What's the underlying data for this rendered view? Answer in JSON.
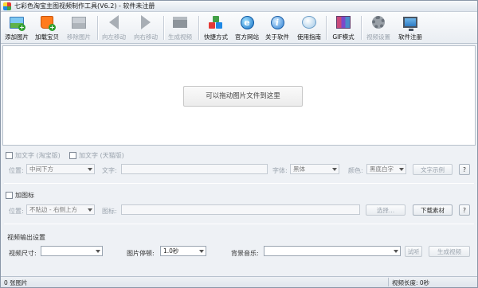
{
  "window": {
    "title": "七彩色淘宝主图视频制作工具(V6.2) - 软件未注册"
  },
  "toolbar": {
    "buttons": [
      {
        "label": "添加图片",
        "icon": "add-image-icon",
        "enabled": true
      },
      {
        "label": "加载宝贝",
        "icon": "taobao-bag-icon",
        "enabled": true
      },
      {
        "label": "移除图片",
        "icon": "remove-image-icon",
        "enabled": false
      },
      {
        "label": "向左移动",
        "icon": "arrow-left-icon",
        "enabled": false
      },
      {
        "label": "向右移动",
        "icon": "arrow-right-icon",
        "enabled": false
      },
      {
        "label": "生成视频",
        "icon": "clapperboard-icon",
        "enabled": false
      },
      {
        "label": "快捷方式",
        "icon": "cubes-icon",
        "enabled": true
      },
      {
        "label": "官方网站",
        "icon": "ie-globe-icon",
        "enabled": true
      },
      {
        "label": "关于软件",
        "icon": "info-icon",
        "enabled": true
      },
      {
        "label": "使用指南",
        "icon": "help-icon",
        "enabled": true
      },
      {
        "label": "GIF模式",
        "icon": "gif-icon",
        "enabled": true
      },
      {
        "label": "视频设置",
        "icon": "gear-icon",
        "enabled": false
      },
      {
        "label": "软件注册",
        "icon": "monitor-icon",
        "enabled": true
      }
    ]
  },
  "drop_area": {
    "hint": "可以拖动图片文件到这里"
  },
  "text_section": {
    "checkbox_taobao": "加文字 (淘宝版)",
    "checkbox_tmall": "加文字 (天猫版)",
    "position_label": "位置:",
    "position_value": "中间下方",
    "text_label": "文字:",
    "text_value": "",
    "font_label": "字体:",
    "font_value": "黑体",
    "color_label": "颜色:",
    "color_value": "黑底白字",
    "example_button": "文字示例",
    "help_button": "?"
  },
  "logo_section": {
    "checkbox": "加图标",
    "position_label": "位置:",
    "position_value": "不贴边 - 右侧上方",
    "icon_label": "图标:",
    "icon_value": "",
    "select_button": "选择...",
    "download_button": "下载素材",
    "help_button": "?"
  },
  "output_section": {
    "heading": "视频输出设置",
    "size_label": "视频尺寸:",
    "size_value": "",
    "duration_label": "图片停顿:",
    "duration_value": "1.0秒",
    "music_label": "背景音乐:",
    "music_value": "",
    "preview_button": "试听",
    "generate_button": "生成视频"
  },
  "statusbar": {
    "image_count": "0 张图片",
    "video_length": "视频长度: 0秒"
  }
}
